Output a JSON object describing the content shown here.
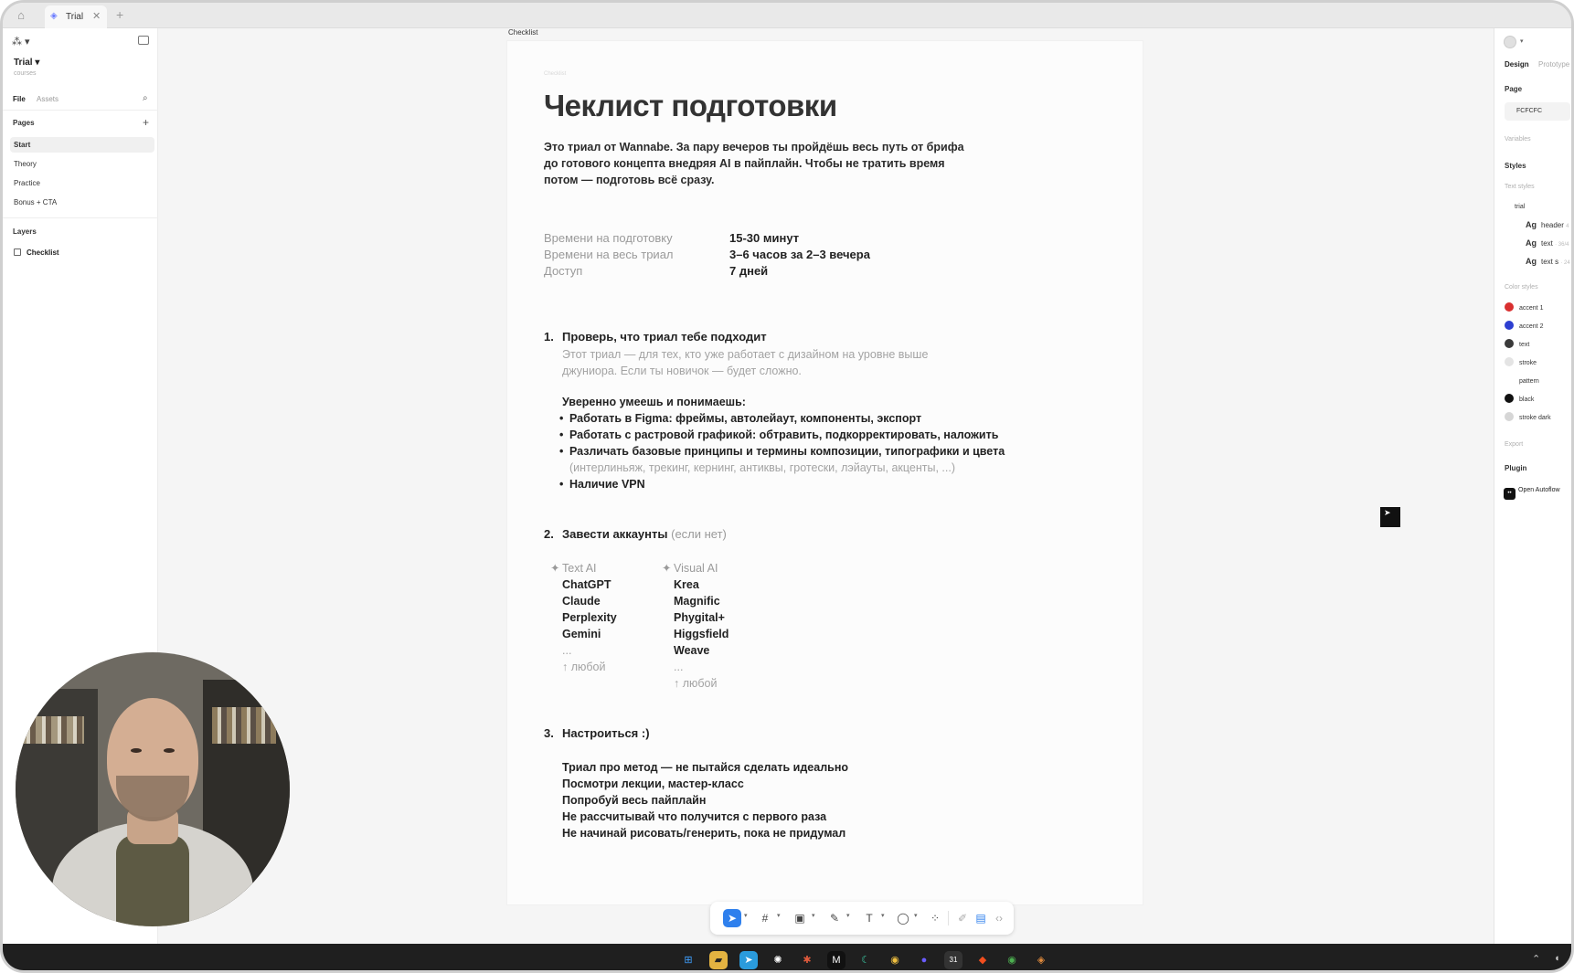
{
  "tabbar": {
    "tab_label": "Trial",
    "add_label": "+"
  },
  "sidebar": {
    "file_name": "Trial",
    "file_sub": "courses",
    "tabs": {
      "file": "File",
      "assets": "Assets"
    },
    "pages_title": "Pages",
    "pages": [
      "Start",
      "Theory",
      "Practice",
      "Bonus + CTA"
    ],
    "active_page": "Start",
    "layers_title": "Layers",
    "layer": "Checklist"
  },
  "canvas": {
    "frame_label": "Checklist",
    "doc_tiny": "Checklist",
    "title": "Чеклист подготовки",
    "intro": "Это триал от Wannabe. За пару вечеров ты пройдёшь весь путь от брифа до готового концепта внедряя AI в пайплайн. Чтобы не тратить время потом — подготовь всё сразу.",
    "info": [
      {
        "key": "Времени на подготовку",
        "value": "15-30 минут"
      },
      {
        "key": "Времени на весь триал",
        "value": "3–6 часов за 2–3 вечера"
      },
      {
        "key": "Доступ",
        "value": "7 дней"
      }
    ],
    "section1": {
      "num": "1.",
      "title": "Проверь, что триал тебе подходит",
      "desc": "Этот триал — для тех, кто уже работает с дизайном на уровне выше джуниора. Если ты новичок — будет сложно.",
      "skills_title": "Уверенно умеешь и понимаешь:",
      "skills": [
        "Работать в Figma: фреймы, автолейаут, компоненты, экспорт",
        "Работать с растровой графикой: обтравить, подкорректировать, наложить",
        "Различать базовые принципы и термины композиции, типографики и цвета"
      ],
      "skills_note": "(интерлиньяж, трекинг, кернинг, антиквы, гротески, лэйауты, акценты, ...)",
      "vpn": "Наличие VPN"
    },
    "section2": {
      "num": "2.",
      "title": "Завести аккаунты",
      "title_note": "(если нет)",
      "text_ai": {
        "head": "Text AI",
        "items": [
          "ChatGPT",
          "Claude",
          "Perplexity",
          "Gemini"
        ],
        "more": "...",
        "any": "↑ любой"
      },
      "visual_ai": {
        "head": "Visual AI",
        "items": [
          "Krea",
          "Magnific",
          "Phygital+",
          "Higgsfield",
          "Weave"
        ],
        "more": "...",
        "any": "↑ любой"
      }
    },
    "section3": {
      "num": "3.",
      "title": "Настроиться :)",
      "tips": [
        "Триал про метод — не пытайся сделать идеально",
        "Посмотри лекции, мастер-класс",
        "Попробуй весь пайплайн",
        "Не рассчитывай что получится с первого раза",
        "Не начинай рисовать/генерить, пока не придумал"
      ]
    }
  },
  "right_panel": {
    "tabs": {
      "design": "Design",
      "prototype": "Prototype"
    },
    "page_title": "Page",
    "page_color": "FCFCFC",
    "variables": "Variables",
    "styles": "Styles",
    "text_styles": "Text styles",
    "group": "trial",
    "text_style_list": [
      {
        "ag": "Ag",
        "name": "header",
        "extra": "4"
      },
      {
        "ag": "Ag",
        "name": "text",
        "extra": "· 36/4"
      },
      {
        "ag": "Ag",
        "name": "text s",
        "extra": "· 24"
      }
    ],
    "color_styles": "Color styles",
    "colors": [
      {
        "name": "accent 1",
        "color": "#d93030"
      },
      {
        "name": "accent 2",
        "color": "#2d3fd1"
      },
      {
        "name": "text",
        "color": "#3a3a3a"
      },
      {
        "name": "stroke",
        "color": "#e4e4e4"
      },
      {
        "name": "pattern",
        "color": "#ffffff"
      },
      {
        "name": "black",
        "color": "#111111"
      },
      {
        "name": "stroke dark",
        "color": "#d6d6d6"
      }
    ],
    "export": "Export",
    "plugin": "Plugin",
    "plugin_name": "Open Autoflow"
  },
  "toolbar": {
    "tools": [
      "move-tool",
      "frame-tool",
      "image-tool",
      "pen-tool",
      "text-tool",
      "comment-tool",
      "actions-tool",
      "draw-mode",
      "design-mode",
      "dev-mode"
    ],
    "active_tool": "move-tool"
  },
  "accent": "#2f80ed"
}
